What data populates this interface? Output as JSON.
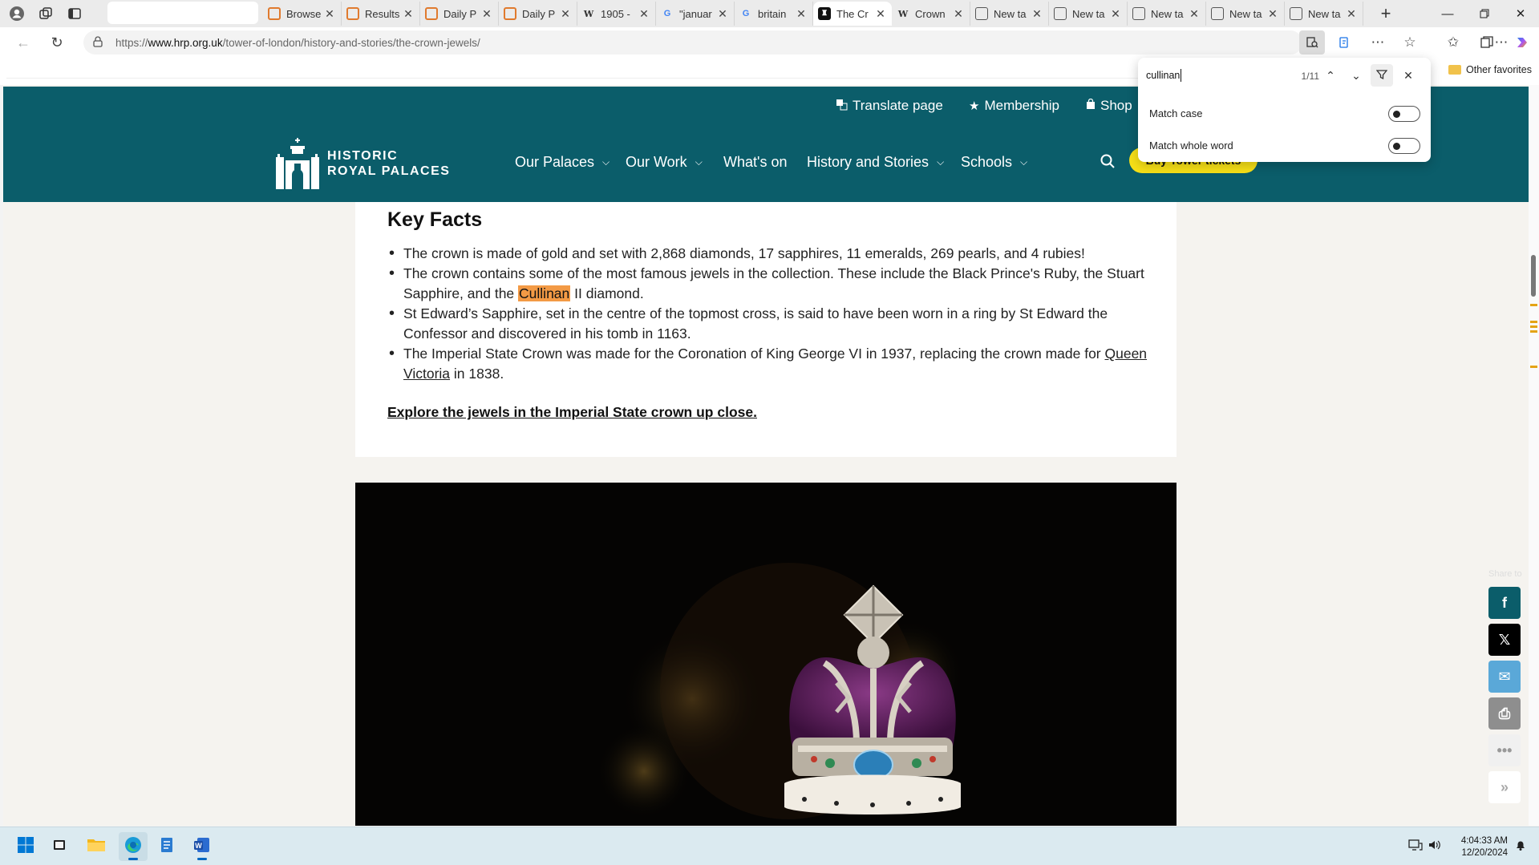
{
  "tabs": [
    {
      "label": "Browse",
      "favicon": "history-icon",
      "color": "#e07a2e"
    },
    {
      "label": "Results",
      "favicon": "history-icon",
      "color": "#e07a2e"
    },
    {
      "label": "Daily P",
      "favicon": "history-icon",
      "color": "#e07a2e"
    },
    {
      "label": "Daily P",
      "favicon": "history-icon",
      "color": "#e07a2e"
    },
    {
      "label": "1905 -",
      "favicon": "wikipedia-icon",
      "color": "#000000"
    },
    {
      "label": "\"januar",
      "favicon": "google-icon",
      "color": "#4285f4"
    },
    {
      "label": "britain",
      "favicon": "google-icon",
      "color": "#4285f4"
    },
    {
      "label": "The Cr",
      "favicon": "hrp-icon",
      "color": "#0b5d6a",
      "active": true
    },
    {
      "label": "Crown",
      "favicon": "wikipedia-icon",
      "color": "#000000"
    },
    {
      "label": "New ta",
      "favicon": "new-tab-icon",
      "color": "#555555"
    },
    {
      "label": "New ta",
      "favicon": "new-tab-icon",
      "color": "#555555"
    },
    {
      "label": "New ta",
      "favicon": "new-tab-icon",
      "color": "#555555"
    },
    {
      "label": "New ta",
      "favicon": "new-tab-icon",
      "color": "#555555"
    },
    {
      "label": "New ta",
      "favicon": "new-tab-icon",
      "color": "#555555"
    }
  ],
  "address": {
    "url_prefix": "https://",
    "url_host": "www.hrp.org.uk",
    "url_path": "/tower-of-london/history-and-stories/the-crown-jewels/"
  },
  "favorites": {
    "other_label": "Other favorites"
  },
  "find": {
    "query": "cullinan",
    "count": "1/11",
    "match_case_label": "Match case",
    "match_whole_word_label": "Match whole word"
  },
  "site": {
    "brand": "#0b5d6a",
    "utility": {
      "translate": "Translate page",
      "membership": "Membership",
      "shop": "Shop"
    },
    "logo_line1": "HISTORIC",
    "logo_line2": "ROYAL PALACES",
    "nav": [
      "Our Palaces",
      "Our Work",
      "What's on",
      "History and Stories",
      "Schools"
    ],
    "buy_button": "Buy Tower tickets"
  },
  "content": {
    "heading": "Key Facts",
    "fact1": "The crown is made of gold and set with 2,868 diamonds, 17 sapphires, 11 emeralds, 269 pearls, and 4 rubies!",
    "fact2_before": "The crown contains some of the most famous jewels in the collection. These include the Black Prince's Ruby, the Stuart Sapphire, and the ",
    "fact2_highlight": "Cullinan",
    "fact2_after": " II diamond.",
    "fact3": "St Edward’s Sapphire, set in the centre of the topmost cross, is said to have been worn in a ring by St Edward the Confessor and discovered in his tomb in 1163.",
    "fact4_before": "The Imperial State Crown was made for the Coronation of King George VI in 1937, replacing the crown made for ",
    "fact4_link": "Queen Victoria",
    "fact4_after": " in 1838.",
    "explore_link": "Explore the jewels in the Imperial State crown up close."
  },
  "share": {
    "label": "Share to"
  },
  "taskbar": {
    "time": "4:04:33 AM",
    "date": "12/20/2024"
  }
}
